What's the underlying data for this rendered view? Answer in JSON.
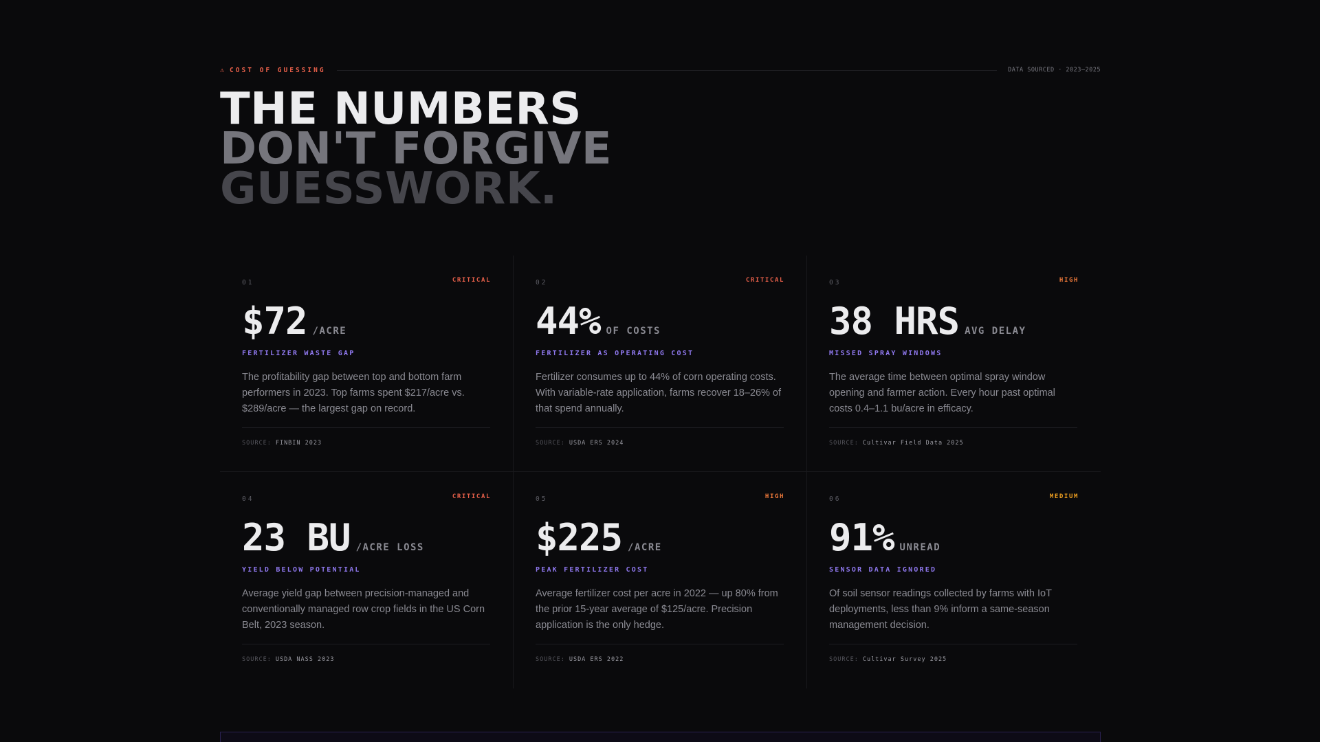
{
  "header": {
    "kicker_icon": "warning-icon",
    "kicker_glyph": "⚠",
    "kicker": "COST OF GUESSING",
    "sourced": "DATA SOURCED · 2023–2025"
  },
  "headline": {
    "line1": "THE NUMBERS",
    "line2": "DON'T FORGIVE",
    "line3": "GUESSWORK."
  },
  "source_prefix": "SOURCE:",
  "cards": [
    {
      "index": "01",
      "severity": "CRITICAL",
      "value": "$72",
      "unit": "/ACRE",
      "label": "FERTILIZER WASTE GAP",
      "description": "The profitability gap between top and bottom farm performers in 2023. Top farms spent $217/acre vs. $289/acre — the largest gap on record.",
      "source": "FINBIN 2023"
    },
    {
      "index": "02",
      "severity": "CRITICAL",
      "value": "44%",
      "unit": "OF COSTS",
      "label": "FERTILIZER AS OPERATING COST",
      "description": "Fertilizer consumes up to 44% of corn operating costs. With variable-rate application, farms recover 18–26% of that spend annually.",
      "source": "USDA ERS 2024"
    },
    {
      "index": "03",
      "severity": "HIGH",
      "value": "38 HRS",
      "unit": "AVG DELAY",
      "label": "MISSED SPRAY WINDOWS",
      "description": "The average time between optimal spray window opening and farmer action. Every hour past optimal costs 0.4–1.1 bu/acre in efficacy.",
      "source": "Cultivar Field Data 2025"
    },
    {
      "index": "04",
      "severity": "CRITICAL",
      "value": "23 BU",
      "unit": "/ACRE LOSS",
      "label": "YIELD BELOW POTENTIAL",
      "description": "Average yield gap between precision-managed and conventionally managed row crop fields in the US Corn Belt, 2023 season.",
      "source": "USDA NASS 2023"
    },
    {
      "index": "05",
      "severity": "HIGH",
      "value": "$225",
      "unit": "/ACRE",
      "label": "PEAK FERTILIZER COST",
      "description": "Average fertilizer cost per acre in 2022 — up 80% from the prior 15-year average of $125/acre. Precision application is the only hedge.",
      "source": "USDA ERS 2022"
    },
    {
      "index": "06",
      "severity": "MEDIUM",
      "value": "91%",
      "unit": "UNREAD",
      "label": "SENSOR DATA IGNORED",
      "description": "Of soil sensor readings collected by farms with IoT deployments, less than 9% inform a same-season management decision.",
      "source": "Cultivar Survey 2025"
    }
  ],
  "colors": {
    "background": "#0a0a0c",
    "critical": "#e8604a",
    "high": "#f07a3a",
    "medium": "#f0a020",
    "accent_label": "#8f78ee"
  }
}
